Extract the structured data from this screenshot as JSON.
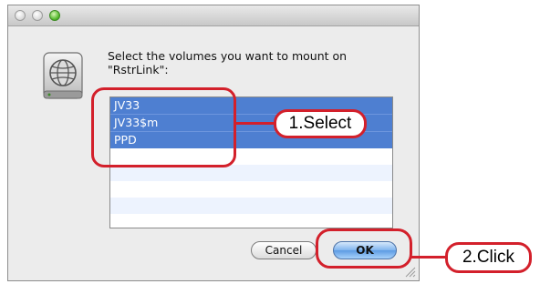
{
  "dialog": {
    "prompt": "Select the volumes you want to mount on\n\"RstrLink\":",
    "volumes": [
      {
        "label": "JV33",
        "selected": true
      },
      {
        "label": "JV33$m",
        "selected": true
      },
      {
        "label": "PPD",
        "selected": true
      },
      {
        "label": "",
        "selected": false
      },
      {
        "label": "",
        "selected": false
      },
      {
        "label": "",
        "selected": false
      },
      {
        "label": "",
        "selected": false
      }
    ],
    "cancel_label": "Cancel",
    "ok_label": "OK",
    "icon": "network-drive-icon"
  },
  "annotations": {
    "step1": "1.Select",
    "step2": "2.Click",
    "color": "#d3202b"
  },
  "colors": {
    "selection": "#4e7fd1",
    "zoom_button": "#53b82c"
  }
}
